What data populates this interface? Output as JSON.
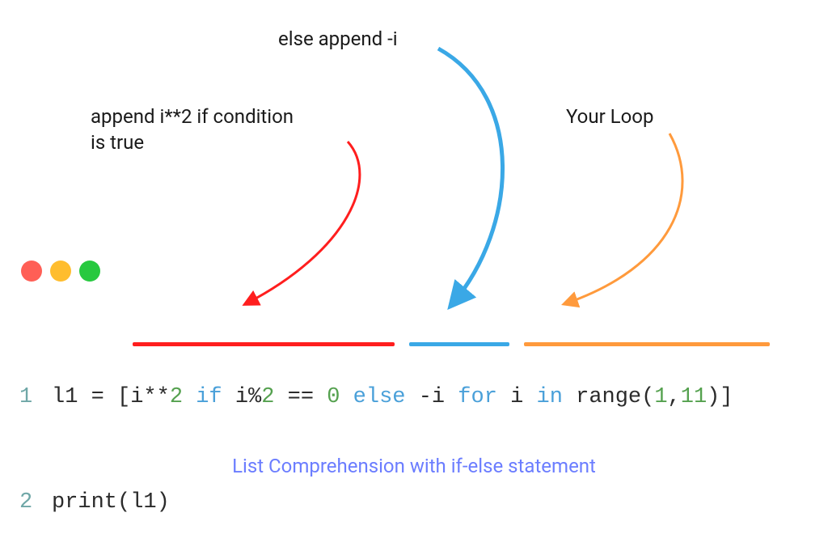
{
  "annotations": {
    "else_branch": "else append -i",
    "if_branch_line1": "append i**2 if condition",
    "if_branch_line2": "is true",
    "loop": "Your Loop"
  },
  "traffic_lights": {
    "red": "#ff5f56",
    "yellow": "#ffbd2e",
    "green": "#27c93f"
  },
  "underlines": {
    "red": "#ff1e1e",
    "blue": "#3aa8e6",
    "orange": "#ff9a3c"
  },
  "code": {
    "line1_num": "1",
    "line2_num": "2",
    "l1": "l1",
    "eq": " = [",
    "i": "i",
    "pow": "**",
    "two_a": "2",
    "sp1": " ",
    "if": "if",
    "sp2": " ",
    "mod": "i%",
    "two_b": "2",
    "sp3": " ",
    "eqeq": "==",
    "sp4": " ",
    "zero": "0",
    "sp5": " ",
    "else": "else",
    "sp6": " ",
    "neg": "-",
    "i2": "i",
    "sp7": " ",
    "for": "for",
    "sp8": " ",
    "i3": "i",
    "sp9": " ",
    "in": "in",
    "sp10": " ",
    "range": "range(",
    "one": "1",
    "comma": ",",
    "eleven": "11",
    "rparen": ")",
    "rbracket": "]",
    "print": "print",
    "lparen2": "(",
    "l1b": "l1",
    "rparen2": ")"
  },
  "caption": "List Comprehension with if-else statement",
  "colors": {
    "arrow_red": "#ff1e1e",
    "arrow_blue": "#3aa8e6",
    "arrow_orange": "#ff9a3c"
  }
}
